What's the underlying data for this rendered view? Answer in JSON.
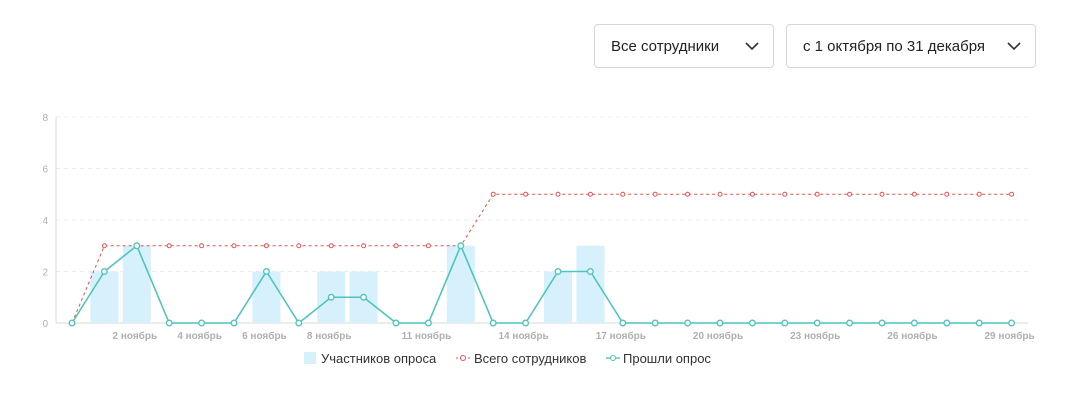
{
  "filters": {
    "employees": "Все сотрудники",
    "period": "с 1 октября по 31 декабря"
  },
  "chart_data": {
    "type": "bar+line",
    "categories": [
      "1 ноябрь",
      "2 ноябрь",
      "3 ноябрь",
      "4 ноябрь",
      "5 ноябрь",
      "6 ноябрь",
      "7 ноябрь",
      "8 ноябрь",
      "9 ноябрь",
      "10 ноябрь",
      "11 ноябрь",
      "12 ноябрь",
      "13 ноябрь",
      "14 ноябрь",
      "15 ноябрь",
      "16 ноябрь",
      "17 ноябрь",
      "18 ноябрь",
      "19 ноябрь",
      "20 ноябрь",
      "21 ноябрь",
      "22 ноябрь",
      "23 ноябрь",
      "24 ноябрь",
      "25 ноябрь",
      "26 ноябрь",
      "27 ноябрь",
      "28 ноябрь",
      "29 ноябрь",
      "30 ноябрь"
    ],
    "xtick_labels": [
      "2 ноябрь",
      "4 ноябрь",
      "6 ноябрь",
      "8 ноябрь",
      "11 ноябрь",
      "14 ноябрь",
      "17 ноябрь",
      "20 ноябрь",
      "23 ноябрь",
      "26 ноябрь",
      "29 ноябрь"
    ],
    "xtick_indices": [
      2,
      4,
      6,
      8,
      11,
      14,
      17,
      20,
      23,
      26,
      29
    ],
    "series": [
      {
        "name": "Участников опроса",
        "type": "bar",
        "color": "#d6f0fc",
        "values": [
          0,
          2,
          3,
          0,
          0,
          0,
          2,
          0,
          2,
          2,
          0,
          0,
          3,
          0,
          0,
          2,
          3,
          0,
          0,
          0,
          0,
          0,
          0,
          0,
          0,
          0,
          0,
          0,
          0,
          0
        ]
      },
      {
        "name": "Всего сотрудников",
        "type": "line",
        "style": "dashed",
        "color": "#e05252",
        "values": [
          0,
          3,
          3,
          3,
          3,
          3,
          3,
          3,
          3,
          3,
          3,
          3,
          3,
          5,
          5,
          5,
          5,
          5,
          5,
          5,
          5,
          5,
          5,
          5,
          5,
          5,
          5,
          5,
          5,
          5
        ]
      },
      {
        "name": "Прошли опрос",
        "type": "line",
        "color": "#4fc4bd",
        "values": [
          0,
          2,
          3,
          0,
          0,
          0,
          2,
          0,
          1,
          1,
          0,
          0,
          3,
          0,
          0,
          2,
          2,
          0,
          0,
          0,
          0,
          0,
          0,
          0,
          0,
          0,
          0,
          0,
          0,
          0
        ]
      }
    ],
    "ylim": [
      0,
      8
    ],
    "yticks": [
      "0",
      "2",
      "4",
      "6",
      "8"
    ],
    "grid": true,
    "legend_position": "bottom"
  }
}
